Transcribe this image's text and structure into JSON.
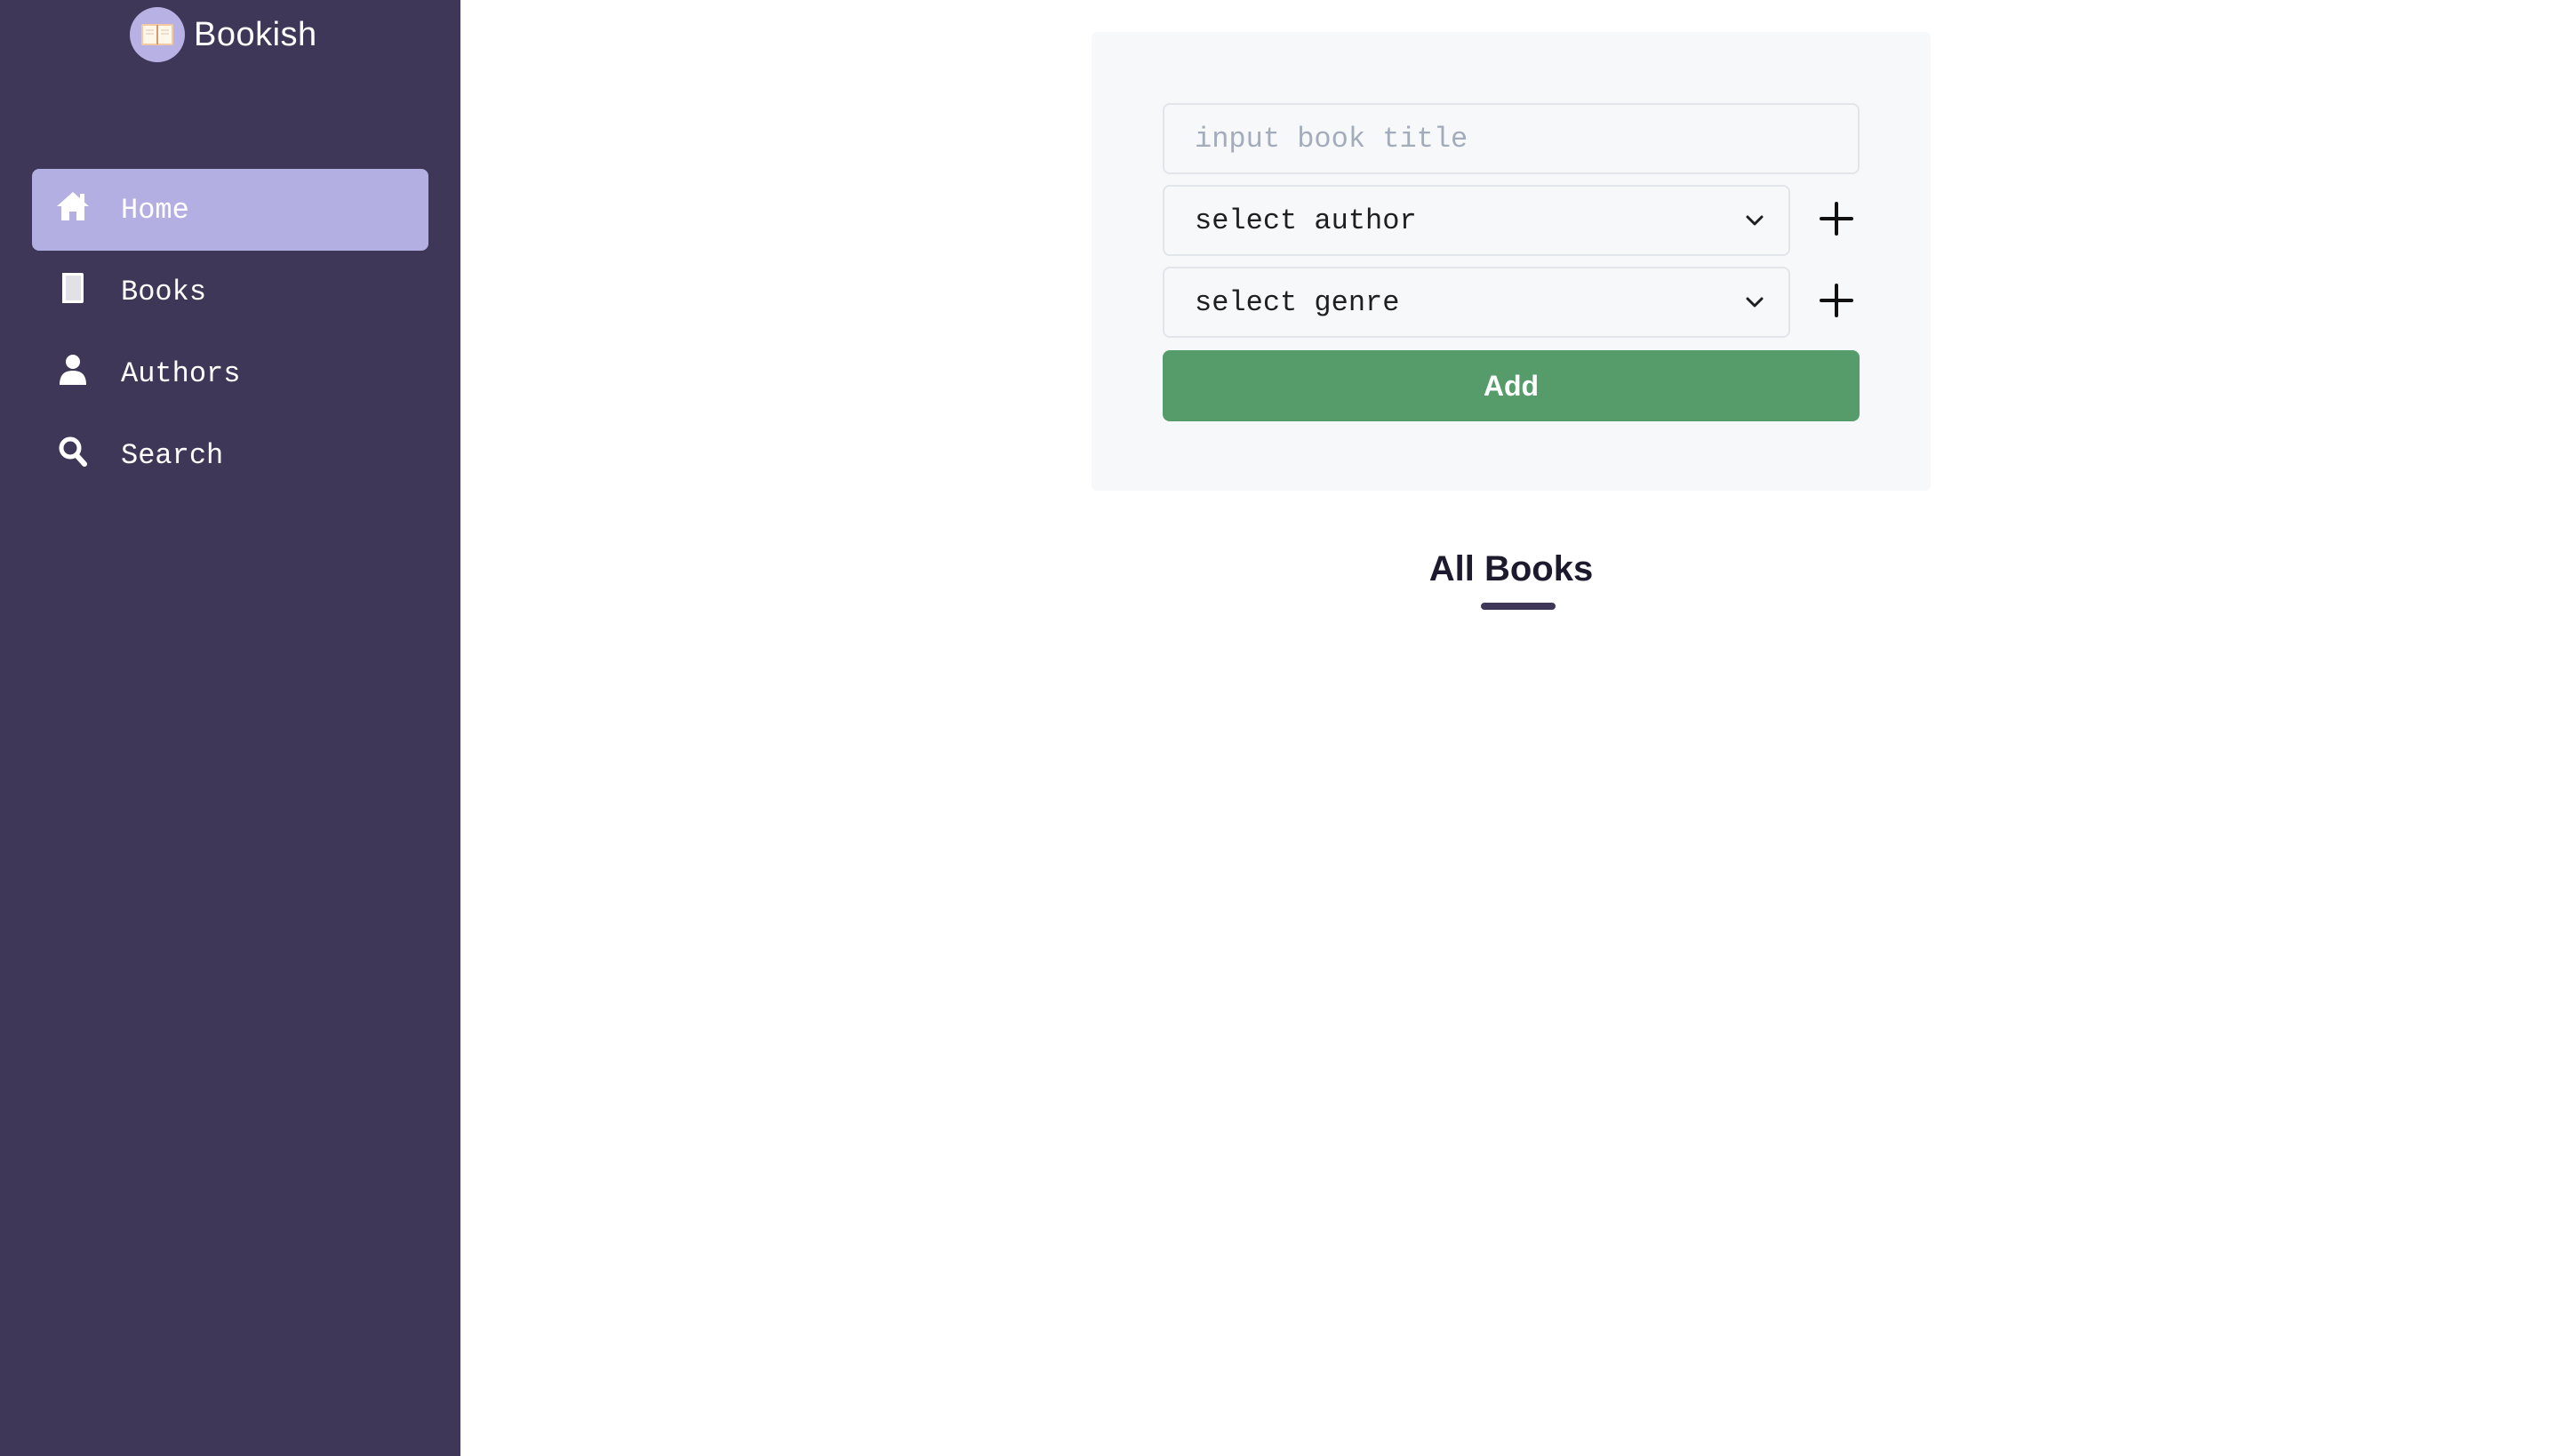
{
  "brand": {
    "title": "Bookish",
    "logo_icon": "open-book-icon"
  },
  "sidebar": {
    "items": [
      {
        "label": "Home",
        "icon": "home-icon",
        "active": true
      },
      {
        "label": "Books",
        "icon": "book-icon",
        "active": false
      },
      {
        "label": "Authors",
        "icon": "user-icon",
        "active": false
      },
      {
        "label": "Search",
        "icon": "search-icon",
        "active": false
      }
    ]
  },
  "form": {
    "title_placeholder": "input book title",
    "title_value": "",
    "author_select": {
      "selected": "select author",
      "add_icon": "plus-icon"
    },
    "genre_select": {
      "selected": "select genre",
      "add_icon": "plus-icon"
    },
    "add_label": "Add"
  },
  "list": {
    "heading": "All Books"
  },
  "colors": {
    "sidebar_bg": "#3e3757",
    "active_item_bg": "#b4afe3",
    "add_button_bg": "#569c6b",
    "form_card_bg": "#f7f8fa"
  }
}
